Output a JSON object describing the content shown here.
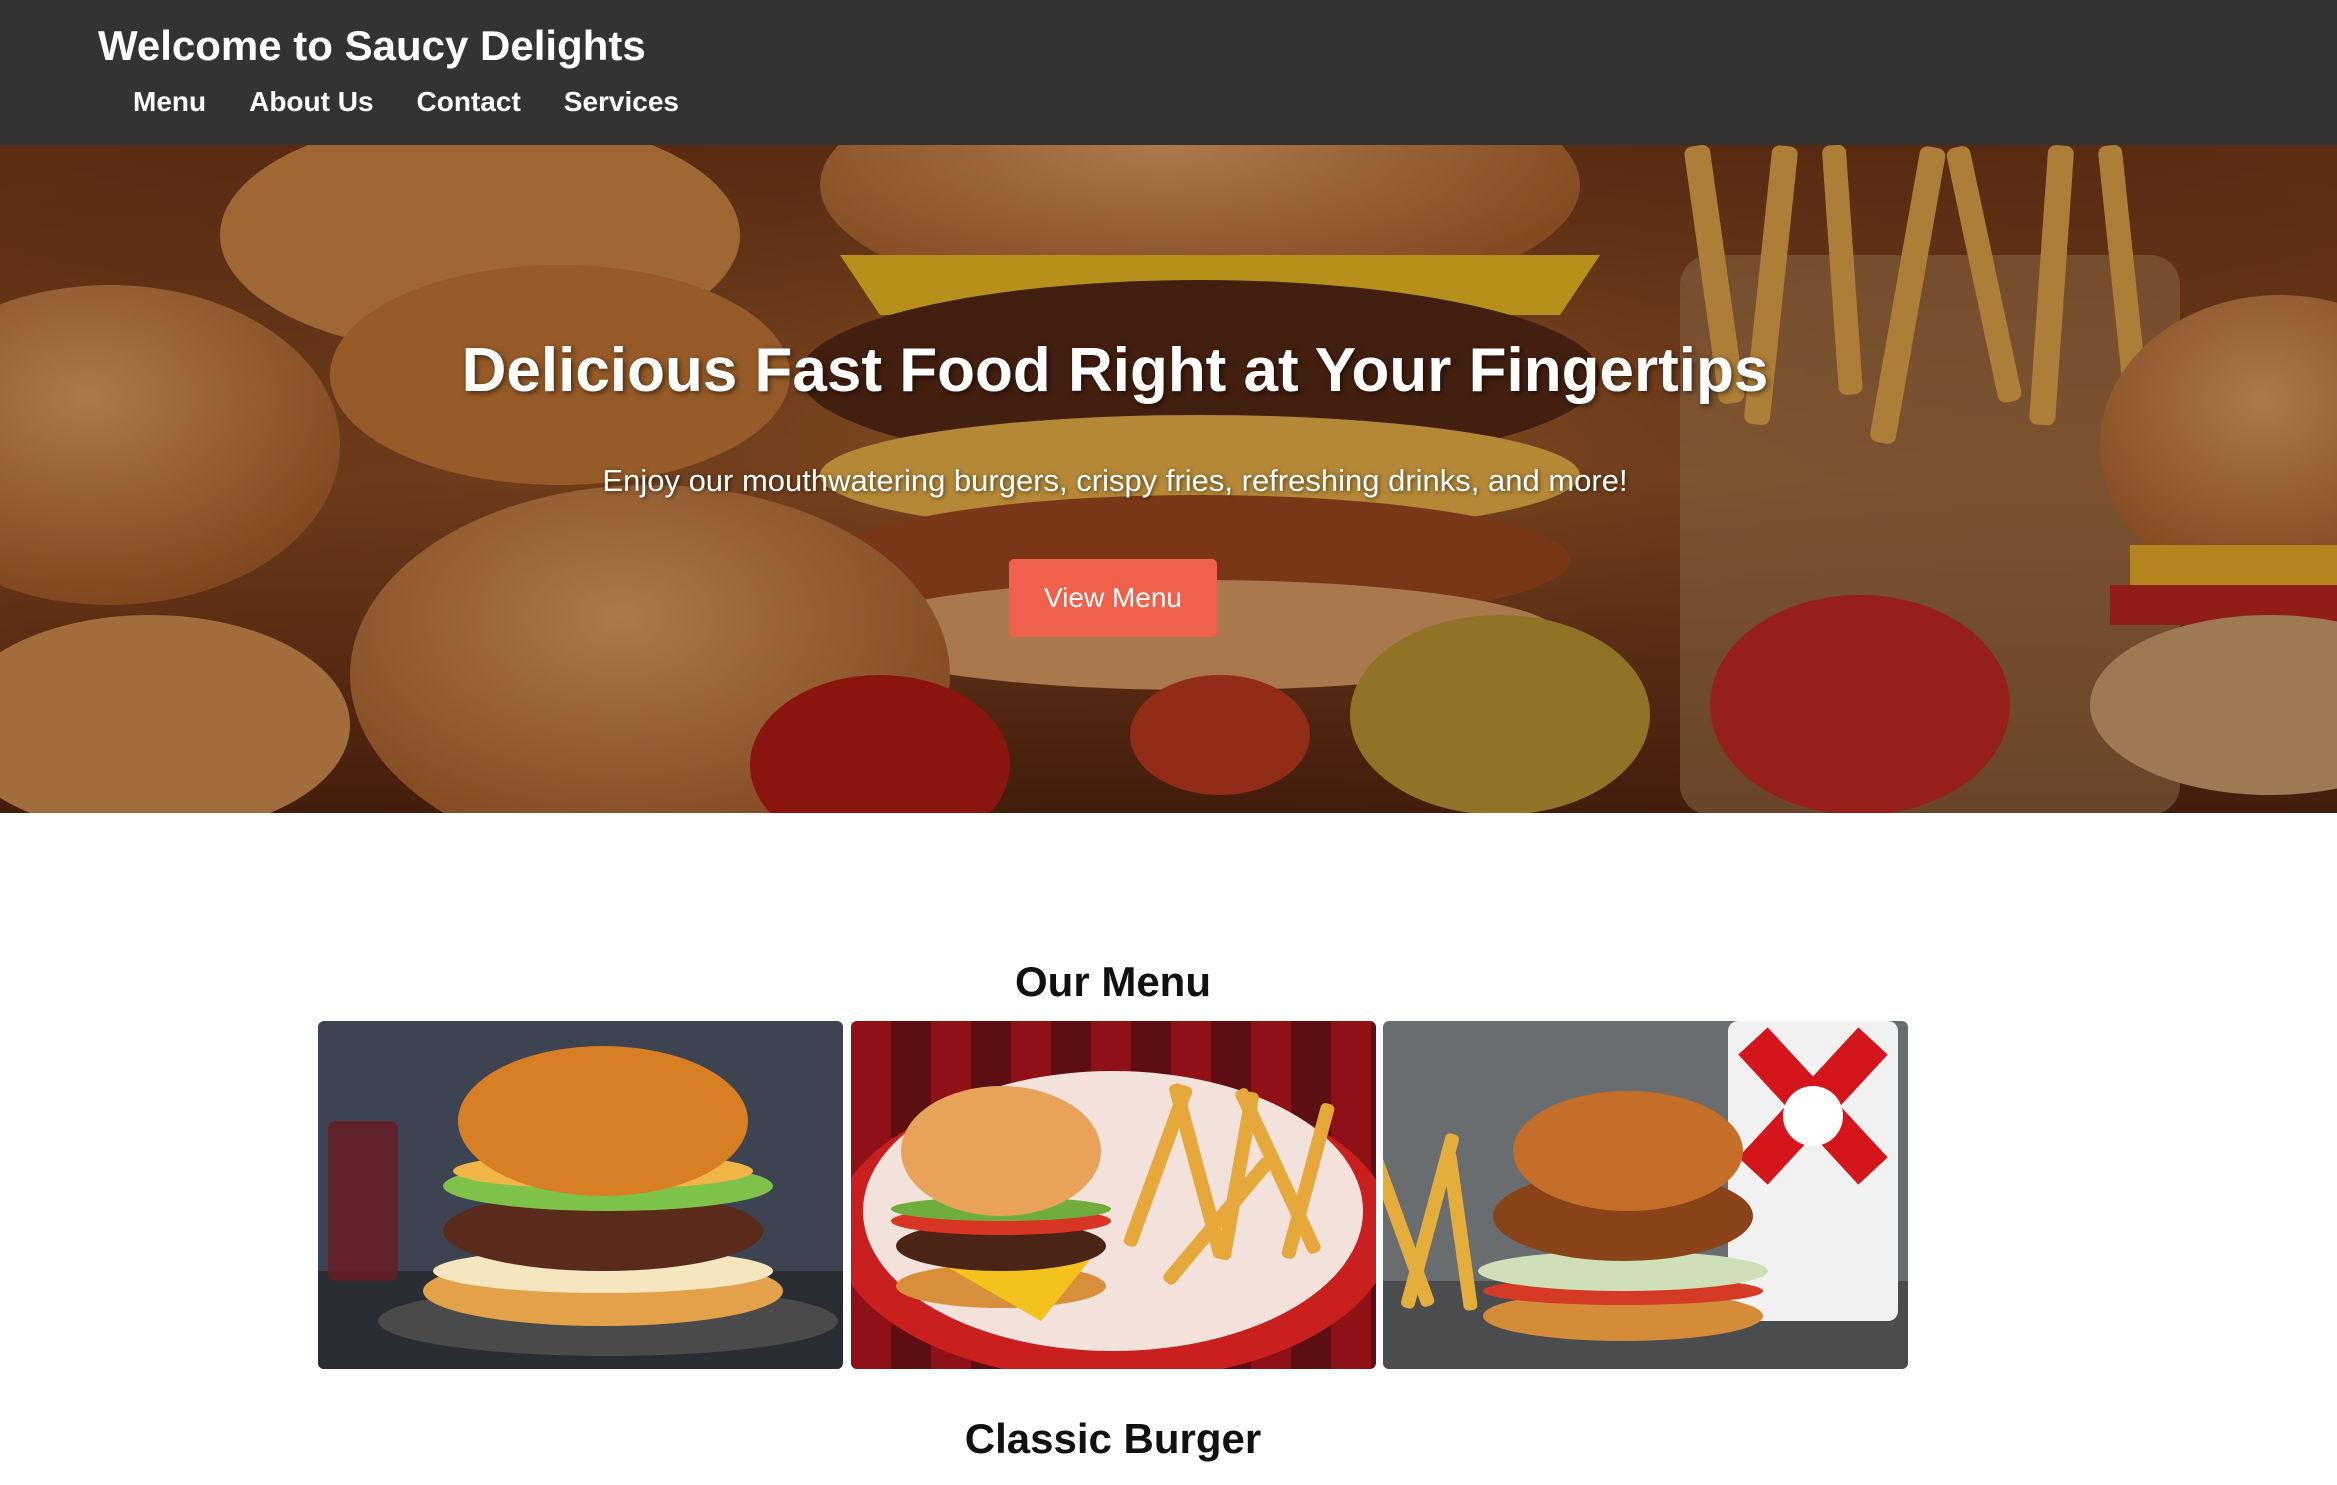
{
  "header": {
    "title": "Welcome to Saucy Delights",
    "nav": [
      "Menu",
      "About Us",
      "Contact",
      "Services"
    ]
  },
  "hero": {
    "headline": "Delicious Fast Food Right at Your Fingertips",
    "subtext": "Enjoy our mouthwatering burgers, crispy fries, refreshing drinks, and more!",
    "button_label": "View Menu"
  },
  "menu_section": {
    "heading": "Our Menu",
    "first_item_name": "Classic Burger"
  },
  "colors": {
    "header_bg": "#333333",
    "button_bg": "#f0604a",
    "text_dark": "#111111"
  }
}
